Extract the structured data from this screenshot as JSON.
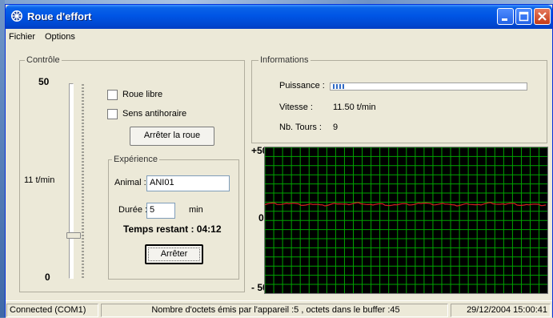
{
  "window": {
    "title": "Roue d'effort",
    "menu": [
      "Fichier",
      "Options"
    ]
  },
  "controle": {
    "label": "Contrôle",
    "slider_max": "50",
    "slider_min": "0",
    "speed_label": "11 t/min",
    "slider_level": 0.22,
    "roue_libre": "Roue libre",
    "sens_antihoraire": "Sens antihoraire",
    "arreter_roue": "Arrêter la roue"
  },
  "experience": {
    "label": "Expérience",
    "animal_label": "Animal :",
    "animal_value": "ANI01",
    "duree_label": "Durée :",
    "duree_value": "5",
    "duree_unit": "min",
    "temps_restant": "Temps restant : 04:12",
    "arreter": "Arrêter"
  },
  "informations": {
    "label": "Informations",
    "puissance_label": "Puissance :",
    "puissance_level": 0.07,
    "vitesse_label": "Vitesse :",
    "vitesse_value": "11.50 t/min",
    "tours_label": "Nb. Tours :",
    "tours_value": "9"
  },
  "scope": {
    "top_label": "+50",
    "mid_label": "0",
    "bottom_label": "- 50",
    "grid_color": "#00a400",
    "trace_color": "#d42020"
  },
  "status": {
    "connection": "Connected (COM1)",
    "message": "Nombre d'octets émis par l'appareil :5 ,  octets dans le buffer :45",
    "datetime": "29/12/2004 15:00:41"
  },
  "colors": {
    "title_bar": "#0055e5",
    "close_button": "#c23a17",
    "progress": "#316ac5"
  }
}
